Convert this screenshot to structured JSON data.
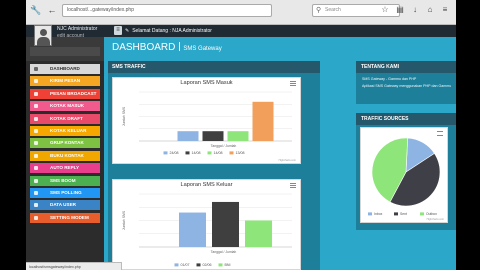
{
  "browser": {
    "url": "localhost/...gateway/index.php",
    "search_placeholder": "Search"
  },
  "topbar": {
    "welcome": "Selamat Datang : NJA Administrator"
  },
  "profile": {
    "name": "NJC Administrator",
    "role": "edit account"
  },
  "sidebar": {
    "items": [
      {
        "label": "DASHBOARD",
        "color": "#d9d9d9",
        "active": true
      },
      {
        "label": "KIRIM PESAN",
        "color": "#f5a623",
        "active": false
      },
      {
        "label": "PESAN BROADCAST",
        "color": "#ef4136",
        "active": false
      },
      {
        "label": "KOTAK MASUK",
        "color": "#f05a8d",
        "active": false
      },
      {
        "label": "KOTAK DRAFT",
        "color": "#e84a6a",
        "active": false
      },
      {
        "label": "KOTAK KELUAR",
        "color": "#f6a700",
        "active": false
      },
      {
        "label": "GRUP KONTAK",
        "color": "#7dc242",
        "active": false
      },
      {
        "label": "BUKU KONTAK",
        "color": "#f0a700",
        "active": false
      },
      {
        "label": "AUTO REPLY",
        "color": "#e83e8c",
        "active": false
      },
      {
        "label": "SMS BOOM",
        "color": "#4caf50",
        "active": false
      },
      {
        "label": "SMS POLLING",
        "color": "#2196f3",
        "active": false
      },
      {
        "label": "DATA USER",
        "color": "#3a84c5",
        "active": false
      },
      {
        "label": "SETTING MODEM",
        "color": "#e85d2c",
        "active": false
      }
    ]
  },
  "main": {
    "title": "DASHBOARD",
    "subtitle": "SMS Gateway"
  },
  "traffic_panel": {
    "header": "SMS TRAFFIC"
  },
  "chart_masuk": {
    "title": "Laporan SMS Masuk",
    "ylabel": "Jumlah SMS",
    "xlabel": "Tanggal / Jumlah",
    "credit": "Highcharts.com",
    "categories": [
      "24/08",
      "14/08",
      "14/08",
      "13/08"
    ],
    "colors": [
      "#8db4e2",
      "#3f3f3f",
      "#8ee57a",
      "#f29f5b"
    ],
    "values": [
      1,
      1,
      1,
      4
    ],
    "ylim": [
      0,
      5
    ]
  },
  "chart_keluar": {
    "title": "Laporan SMS Keluar",
    "ylabel": "Jumlah SMS",
    "xlabel": "Tanggal / Jumlah",
    "credit": "Highcharts.com",
    "categories": [
      "01/07",
      "02/06",
      "BNI"
    ],
    "colors": [
      "#8db4e2",
      "#3f3f3f",
      "#8ee57a"
    ],
    "values": [
      2.6,
      3.4,
      2
    ],
    "ylim": [
      0,
      4
    ]
  },
  "about_panel": {
    "header": "TENTANG KAMI",
    "line1": "SMS Gateway - Gammu dan PHP",
    "line2": "Aplikasi SMS Gateway menggunakan PHP dan Gammu"
  },
  "traffic_sources": {
    "header": "TRAFFIC SOURCES",
    "credit": "Highcharts.com",
    "slices": [
      {
        "name": "Inbox",
        "value": 15,
        "color": "#8db4e2"
      },
      {
        "name": "Sent",
        "value": 42,
        "color": "#3f3f47"
      },
      {
        "name": "Outbox",
        "value": 43,
        "color": "#8ee57a"
      }
    ]
  },
  "statusbar": {
    "text": "localhost/smsgateway/index.php"
  },
  "chart_data": [
    {
      "type": "bar",
      "title": "Laporan SMS Masuk",
      "xlabel": "Tanggal / Jumlah",
      "ylabel": "Jumlah SMS",
      "series": [
        {
          "name": "24/08",
          "values": [
            1
          ]
        },
        {
          "name": "14/08",
          "values": [
            1
          ]
        },
        {
          "name": "14/08",
          "values": [
            1
          ]
        },
        {
          "name": "13/08",
          "values": [
            4
          ]
        }
      ],
      "ylim": [
        0,
        5
      ]
    },
    {
      "type": "bar",
      "title": "Laporan SMS Keluar",
      "xlabel": "Tanggal / Jumlah",
      "ylabel": "Jumlah SMS",
      "series": [
        {
          "name": "01/07",
          "values": [
            2.6
          ]
        },
        {
          "name": "02/06",
          "values": [
            3.4
          ]
        },
        {
          "name": "BNI",
          "values": [
            2
          ]
        }
      ],
      "ylim": [
        0,
        4
      ]
    },
    {
      "type": "pie",
      "categories": [
        "Inbox",
        "Sent",
        "Outbox"
      ],
      "values": [
        15,
        42,
        43
      ]
    }
  ]
}
